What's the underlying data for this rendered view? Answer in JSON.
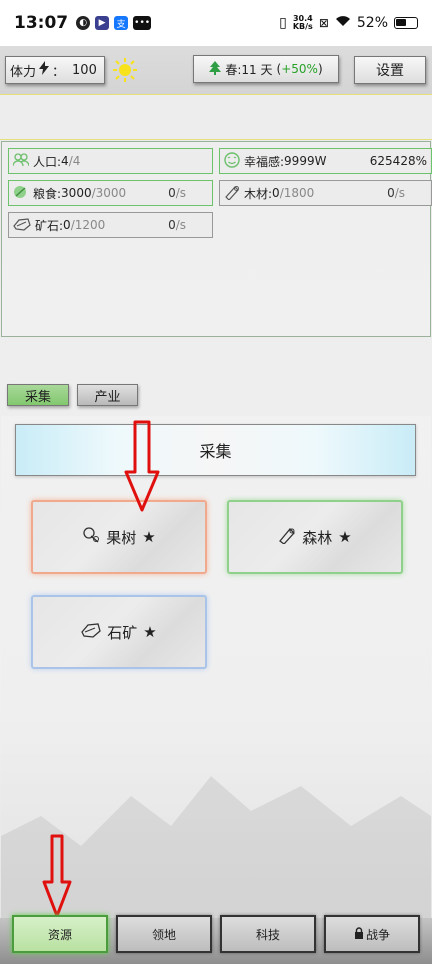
{
  "status_bar": {
    "time": "13:07",
    "net_speed": "30.4",
    "net_unit": "KB/s",
    "battery": "52%"
  },
  "header": {
    "stamina_label": "体力",
    "stamina_sep": "：",
    "stamina_value": "100",
    "season_label": "春:11 天",
    "season_bonus_open": "(",
    "season_bonus": "+50%",
    "season_bonus_close": ")",
    "settings_label": "设置"
  },
  "stats": {
    "population": {
      "label": "人口:",
      "value": "4",
      "max": "/4"
    },
    "happiness": {
      "label": "幸福感:",
      "value": "9999W",
      "percent": "625428%"
    },
    "food": {
      "label": "粮食:",
      "value": "3000",
      "max": "/3000",
      "rate": "0",
      "unit": "/s"
    },
    "wood": {
      "label": "木材:",
      "value": "0",
      "max": "/1800",
      "rate": "0",
      "unit": "/s"
    },
    "ore": {
      "label": "矿石:",
      "value": "0",
      "max": "/1200",
      "rate": "0",
      "unit": "/s"
    }
  },
  "tabs": [
    {
      "label": "采集",
      "active": true
    },
    {
      "label": "产业",
      "active": false
    }
  ],
  "gather": {
    "header": "采集",
    "cards": [
      {
        "label": "果树",
        "star": "★",
        "icon": "fruit-tree-icon"
      },
      {
        "label": "森林",
        "star": "★",
        "icon": "wood-log-icon"
      },
      {
        "label": "石矿",
        "star": "★",
        "icon": "ore-stone-icon"
      }
    ]
  },
  "bottom_nav": [
    {
      "label": "资源",
      "active": true
    },
    {
      "label": "领地",
      "active": false
    },
    {
      "label": "科技",
      "active": false
    },
    {
      "label": "战争",
      "active": false,
      "locked": true
    }
  ],
  "colors": {
    "accent_green": "#29a229",
    "active_tab": "#82c86e",
    "arrow_red": "#e0100f"
  }
}
